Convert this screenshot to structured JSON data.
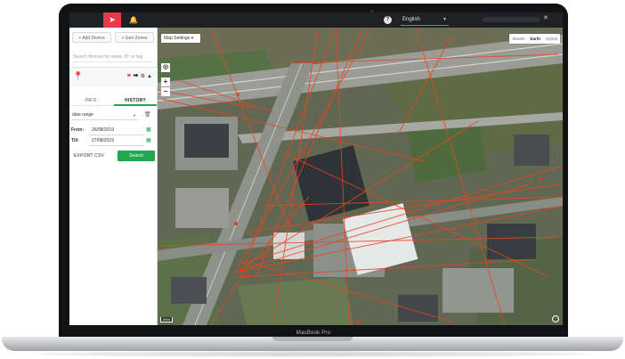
{
  "laptop": {
    "brand": "MacBook Pro"
  },
  "topbar": {
    "nav_icon": "navigation-arrow-icon",
    "bell_icon": "bell-icon",
    "help_icon": "help-icon",
    "help_label": "?",
    "language": "English",
    "close_icon": "close-icon"
  },
  "sidebar": {
    "add_device": "+ Add Device",
    "geo_zones": "+ Geo Zones",
    "search_placeholder": "Search devices by name, ID, or tag",
    "device_icons": [
      "map-pin-icon",
      "share-icon",
      "gear-icon",
      "chevron-up-icon"
    ],
    "tabs": [
      "INFO",
      "HISTORY"
    ],
    "active_tab": "HISTORY",
    "date_range": "date range",
    "from_label": "From:",
    "from_value": "26/08/2019",
    "till_label": "Till:",
    "till_value": "27/08/2019",
    "export_label": "EXPORT CSV",
    "search_label": "Search"
  },
  "map": {
    "settings_label": "Map Settings ▾",
    "types": [
      "Streets",
      "Earth",
      "Hybrid"
    ],
    "selected_type": "Earth",
    "zoom_in": "+",
    "zoom_out": "−",
    "scale_label": "20m",
    "track_color": "#e8451e"
  }
}
